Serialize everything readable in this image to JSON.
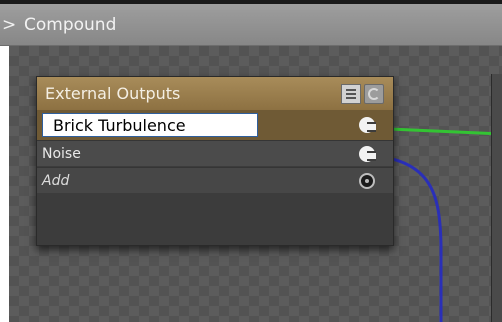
{
  "titlebar": {
    "crumb": ">",
    "title": "Compound"
  },
  "node": {
    "title": "External Outputs",
    "input_value": "Brick Turbulence",
    "rows": [
      {
        "label": "Noise"
      },
      {
        "label": "Add"
      }
    ]
  },
  "colors": {
    "node_header": "#a88c5a",
    "wire_green": "#33c433",
    "wire_blue": "#2a2fb8"
  },
  "icons": {
    "header_left": "list-icon",
    "header_right": "cycle-icon",
    "output_port": "output-port-icon",
    "add_port": "add-port-icon"
  }
}
